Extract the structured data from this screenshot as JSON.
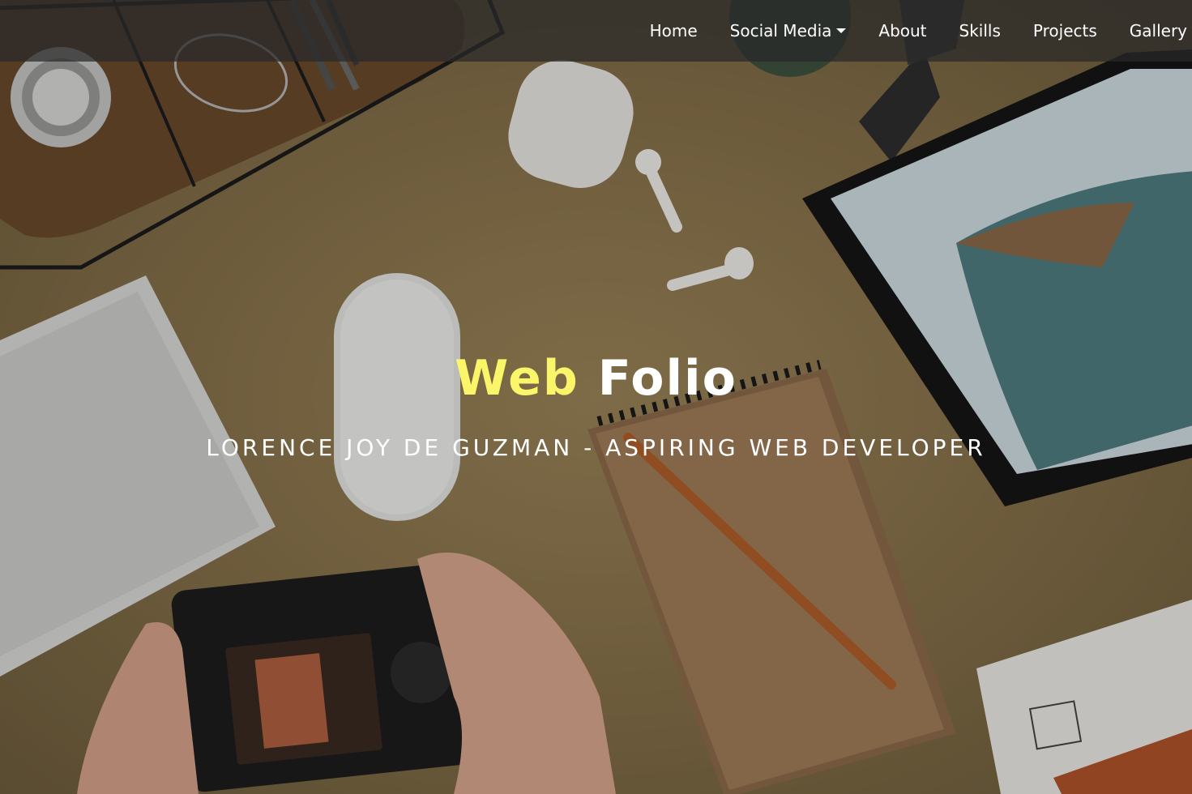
{
  "nav": {
    "items": [
      {
        "label": "Home"
      },
      {
        "label": "Social Media",
        "icon": "caret-down-icon"
      },
      {
        "label": "About"
      },
      {
        "label": "Skills"
      },
      {
        "label": "Projects"
      },
      {
        "label": "Gallery"
      }
    ]
  },
  "hero": {
    "title_part1": "Web",
    "title_part2": "Folio",
    "subtitle": "LORENCE JOY DE GUZMAN - ASPIRING WEB DEVELOPER"
  },
  "colors": {
    "accent": "#fbf56a",
    "navbar_bg": "#282828",
    "text": "#ffffff",
    "desk_background": "#9a8358"
  }
}
